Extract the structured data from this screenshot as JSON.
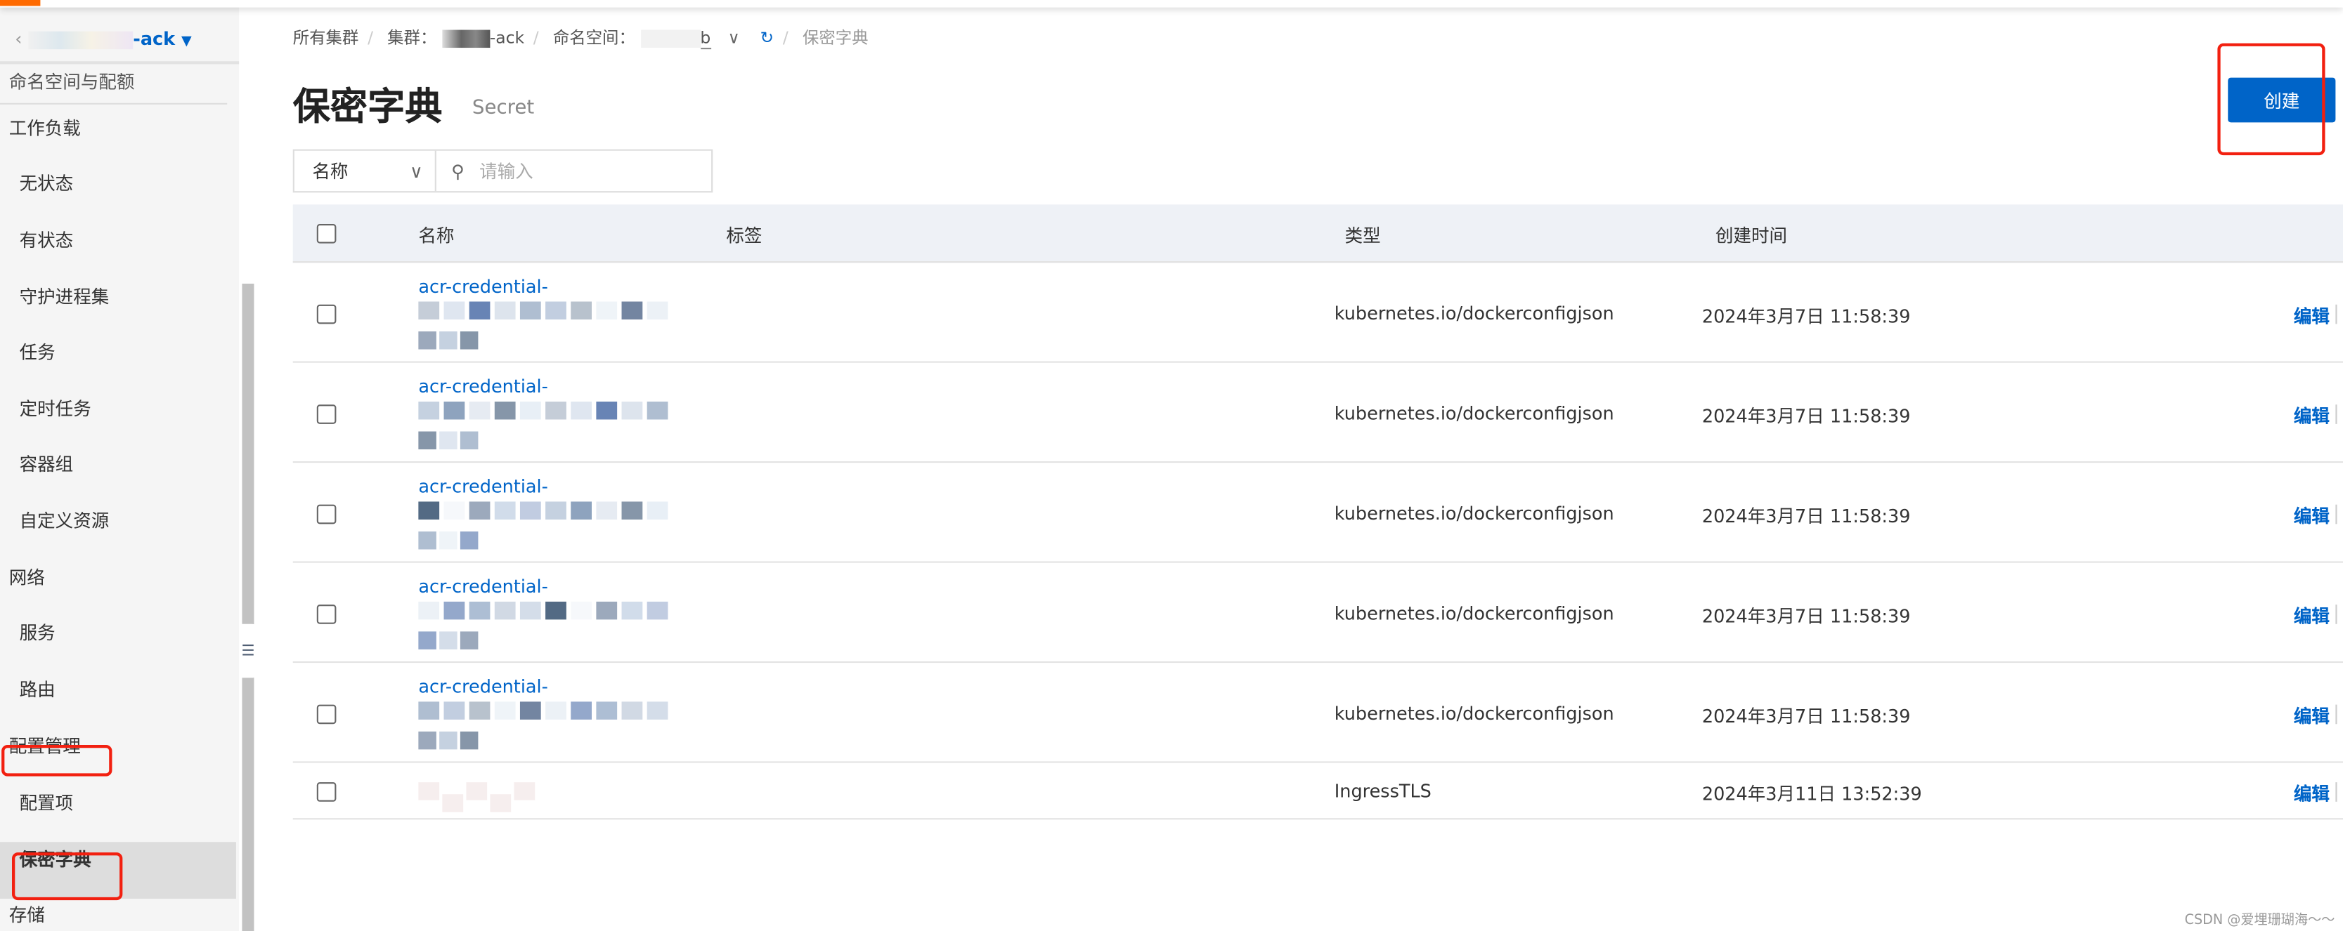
{
  "topbar": {
    "brand_color": "#ff6a00"
  },
  "sidebar": {
    "cluster_name": "-ack",
    "cut_item": "命名空间与配额",
    "items": [
      {
        "label": "工作负载",
        "level": 0
      },
      {
        "label": "无状态",
        "level": 1
      },
      {
        "label": "有状态",
        "level": 1
      },
      {
        "label": "守护进程集",
        "level": 1
      },
      {
        "label": "任务",
        "level": 1
      },
      {
        "label": "定时任务",
        "level": 1
      },
      {
        "label": "容器组",
        "level": 1
      },
      {
        "label": "自定义资源",
        "level": 1
      },
      {
        "label": "网络",
        "level": 0
      },
      {
        "label": "服务",
        "level": 1
      },
      {
        "label": "路由",
        "level": 1
      },
      {
        "label": "配置管理",
        "level": 0
      },
      {
        "label": "配置项",
        "level": 1
      },
      {
        "label": "保密字典",
        "level": 1,
        "selected": true
      },
      {
        "label": "存储",
        "level": 0
      }
    ]
  },
  "breadcrumb": {
    "all_clusters": "所有集群",
    "cluster_label": "集群：",
    "cluster_value": "-ack",
    "namespace_label": "命名空间：",
    "namespace_value": "b",
    "current": "保密字典"
  },
  "page": {
    "title": "保密字典",
    "subtitle": "Secret",
    "create_label": "创建",
    "accent": "#0064c8"
  },
  "filter": {
    "field": "名称",
    "placeholder": "请输入"
  },
  "table": {
    "columns": [
      "名称",
      "标签",
      "类型",
      "创建时间"
    ],
    "rows": [
      {
        "name": "acr-credential-",
        "type": "kubernetes.io/dockerconfigjson",
        "created": "2024年3月7日 11:58:39",
        "action": "编辑"
      },
      {
        "name": "acr-credential-",
        "type": "kubernetes.io/dockerconfigjson",
        "created": "2024年3月7日 11:58:39",
        "action": "编辑"
      },
      {
        "name": "acr-credential-",
        "type": "kubernetes.io/dockerconfigjson",
        "created": "2024年3月7日 11:58:39",
        "action": "编辑"
      },
      {
        "name": "acr-credential-",
        "type": "kubernetes.io/dockerconfigjson",
        "created": "2024年3月7日 11:58:39",
        "action": "编辑"
      },
      {
        "name": "acr-credential-",
        "type": "kubernetes.io/dockerconfigjson",
        "created": "2024年3月7日 11:58:39",
        "action": "编辑"
      },
      {
        "name": "",
        "type": "IngressTLS",
        "created": "2024年3月11日 13:52:39",
        "action": "编辑"
      }
    ]
  },
  "watermark": "CSDN @爱埋珊瑚海～～"
}
